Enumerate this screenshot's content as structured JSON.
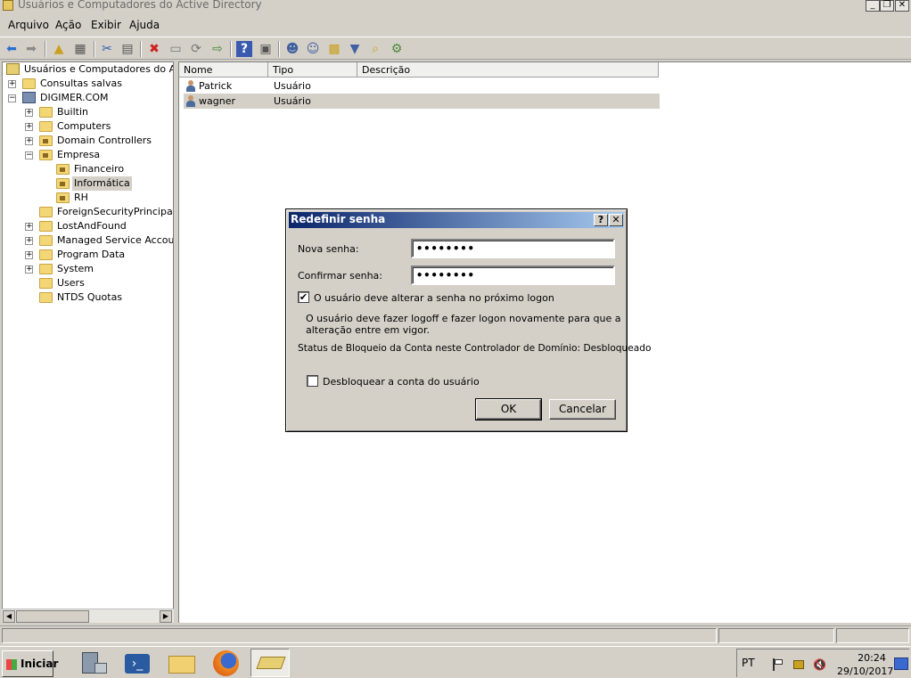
{
  "window": {
    "title": "Usuários e Computadores do Active Directory",
    "min_glyph": "_",
    "max_glyph": "❐",
    "close_glyph": "✕"
  },
  "menu": [
    "Arquivo",
    "Ação",
    "Exibir",
    "Ajuda"
  ],
  "toolbar_icons": [
    "back-arrow-icon",
    "forward-arrow-icon",
    "up-folder-icon",
    "show-tree-icon",
    "cut-icon",
    "paste-icon",
    "delete-icon",
    "properties-icon",
    "refresh-icon",
    "export-icon",
    "help-icon",
    "console-icon",
    "add-user-icon",
    "add-group-icon",
    "add-ou-icon",
    "filter-icon",
    "find-icon",
    "delegate-icon"
  ],
  "tree": {
    "root": "Usuários e Computadores do Active Directory",
    "saved_queries": "Consultas salvas",
    "domain": "DIGIMER.COM",
    "nodes": {
      "builtin": "Builtin",
      "computers": "Computers",
      "domain_controllers": "Domain Controllers",
      "empresa": "Empresa",
      "financeiro": "Financeiro",
      "informatica": "Informática",
      "rh": "RH",
      "fsp": "ForeignSecurityPrincipals",
      "lost_found": "LostAndFound",
      "msa": "Managed Service Accounts",
      "program_data": "Program Data",
      "system": "System",
      "users": "Users",
      "ntds": "NTDS Quotas"
    },
    "expand_plus": "+",
    "expand_minus": "−"
  },
  "list": {
    "columns": [
      "Nome",
      "Tipo",
      "Descrição"
    ],
    "rows": [
      {
        "name": "Patrick",
        "type": "Usuário"
      },
      {
        "name": "wagner",
        "type": "Usuário"
      }
    ]
  },
  "dialog": {
    "title": "Redefinir senha",
    "help_glyph": "?",
    "close_glyph": "✕",
    "new_password_label": "Nova senha:",
    "new_password_value": "••••••••",
    "confirm_password_label": "Confirmar senha:",
    "confirm_password_value": "••••••••",
    "must_change_label": "O usuário deve alterar a senha no próximo logon",
    "must_change_checked": "✔",
    "info_line1": "O usuário deve fazer logoff e fazer logon novamente para que a",
    "info_line2": "alteração entre em vigor.",
    "lockout_status": "Status de Bloqueio da Conta neste Controlador de Domínio: Desbloqueado",
    "unlock_label": "Desbloquear a conta do usuário",
    "ok_label": "OK",
    "cancel_label": "Cancelar"
  },
  "taskbar": {
    "start_label": "Iniciar",
    "language": "PT",
    "time": "20:24",
    "date": "29/10/2017"
  },
  "scroll": {
    "left_glyph": "◀",
    "right_glyph": "▶"
  }
}
